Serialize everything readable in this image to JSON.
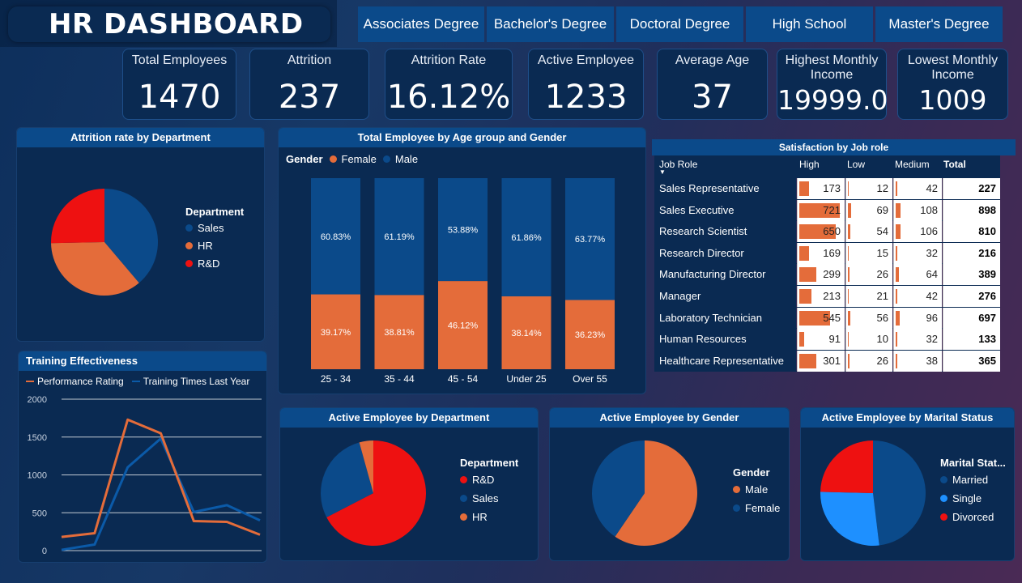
{
  "title": "HR DASHBOARD",
  "education_filters": [
    "Associates Degree",
    "Bachelor's Degree",
    "Doctoral Degree",
    "High School",
    "Master's Degree"
  ],
  "kpis": [
    {
      "label": "Total Employees",
      "value": "1470"
    },
    {
      "label": "Attrition",
      "value": "237"
    },
    {
      "label": "Attrition Rate",
      "value": "16.12%"
    },
    {
      "label": "Active Employee",
      "value": "1233"
    },
    {
      "label": "Average Age",
      "value": "37"
    },
    {
      "label": "Highest Monthly Income",
      "value": "19999.0"
    },
    {
      "label": "Lowest Monthly Income",
      "value": "1009"
    }
  ],
  "colors": {
    "blue": "#0b4a8a",
    "orange": "#e46c3a",
    "red": "#ee1111",
    "light_blue": "#1e90ff"
  },
  "attrition_by_dept": {
    "title": "Attrition rate by Department",
    "legend_title": "Department",
    "chart_data": {
      "type": "pie",
      "labels": [
        "Sales",
        "HR",
        "R&D"
      ],
      "values": [
        38.8,
        35.9,
        25.3
      ],
      "colors": [
        "#0b4a8a",
        "#e46c3a",
        "#ee1111"
      ]
    }
  },
  "age_gender": {
    "title": "Total Employee by Age group and Gender",
    "legend_title": "Gender",
    "legend": [
      "Female",
      "Male"
    ],
    "chart_data": {
      "type": "bar",
      "stacked": true,
      "percent": true,
      "categories": [
        "25 - 34",
        "35 - 44",
        "45 - 54",
        "Under 25",
        "Over 55"
      ],
      "series": [
        {
          "name": "Female",
          "values": [
            39.17,
            38.81,
            46.12,
            38.14,
            36.23
          ],
          "labels": [
            "39.17%",
            "38.81%",
            "46.12%",
            "38.14%",
            "36.23%"
          ],
          "color": "#e46c3a"
        },
        {
          "name": "Male",
          "values": [
            60.83,
            61.19,
            53.88,
            61.86,
            63.77
          ],
          "labels": [
            "60.83%",
            "61.19%",
            "53.88%",
            "61.86%",
            "63.77%"
          ],
          "color": "#0b4a8a"
        }
      ]
    }
  },
  "satisfaction": {
    "title": "Satisfaction by Job role",
    "columns": [
      "Job Role",
      "High",
      "Low",
      "Medium",
      "Total"
    ],
    "max_high": 721,
    "rows": [
      {
        "role": "Sales Representative",
        "high": "173",
        "low": "12",
        "medium": "42",
        "total": "227"
      },
      {
        "role": "Sales Executive",
        "high": "721",
        "low": "69",
        "medium": "108",
        "total": "898"
      },
      {
        "role": "Research Scientist",
        "high": "650",
        "low": "54",
        "medium": "106",
        "total": "810"
      },
      {
        "role": "Research Director",
        "high": "169",
        "low": "15",
        "medium": "32",
        "total": "216"
      },
      {
        "role": "Manufacturing Director",
        "high": "299",
        "low": "26",
        "medium": "64",
        "total": "389"
      },
      {
        "role": "Manager",
        "high": "213",
        "low": "21",
        "medium": "42",
        "total": "276"
      },
      {
        "role": "Laboratory Technician",
        "high": "545",
        "low": "56",
        "medium": "96",
        "total": "697"
      },
      {
        "role": "Human Resources",
        "high": "91",
        "low": "10",
        "medium": "32",
        "total": "133"
      },
      {
        "role": "Healthcare Representative",
        "high": "301",
        "low": "26",
        "medium": "38",
        "total": "365"
      }
    ]
  },
  "training": {
    "title": "Training Effectiveness",
    "legend": [
      "Performance Rating",
      "Training Times Last Year"
    ],
    "chart_data": {
      "type": "line",
      "x": [
        0,
        1,
        2,
        3,
        4,
        5,
        6
      ],
      "ylim": [
        0,
        2000
      ],
      "yticks": [
        "0",
        "500",
        "1000",
        "1500",
        "2000"
      ],
      "series": [
        {
          "name": "Performance Rating",
          "values": [
            180,
            230,
            1730,
            1550,
            390,
            380,
            210
          ],
          "color": "#e46c3a"
        },
        {
          "name": "Training Times Last Year",
          "values": [
            10,
            80,
            1100,
            1480,
            510,
            600,
            400
          ],
          "color": "#0b5aa8"
        }
      ]
    }
  },
  "active_by_dept": {
    "title": "Active Employee by Department",
    "legend_title": "Department",
    "chart_data": {
      "type": "pie",
      "labels": [
        "R&D",
        "Sales",
        "HR"
      ],
      "values": [
        67.4,
        28.3,
        4.3
      ],
      "colors": [
        "#ee1111",
        "#0b4a8a",
        "#e46c3a"
      ]
    }
  },
  "active_by_gender": {
    "title": "Active Employee by Gender",
    "legend_title": "Gender",
    "chart_data": {
      "type": "pie",
      "labels": [
        "Male",
        "Female"
      ],
      "values": [
        59.5,
        40.5
      ],
      "colors": [
        "#e46c3a",
        "#0b4a8a"
      ]
    }
  },
  "active_by_marital": {
    "title": "Active Employee by Marital Status",
    "legend_title": "Marital Stat...",
    "chart_data": {
      "type": "pie",
      "labels": [
        "Married",
        "Single",
        "Divorced"
      ],
      "values": [
        48.1,
        27.3,
        24.6
      ],
      "colors": [
        "#0b4a8a",
        "#1e90ff",
        "#ee1111"
      ]
    }
  }
}
